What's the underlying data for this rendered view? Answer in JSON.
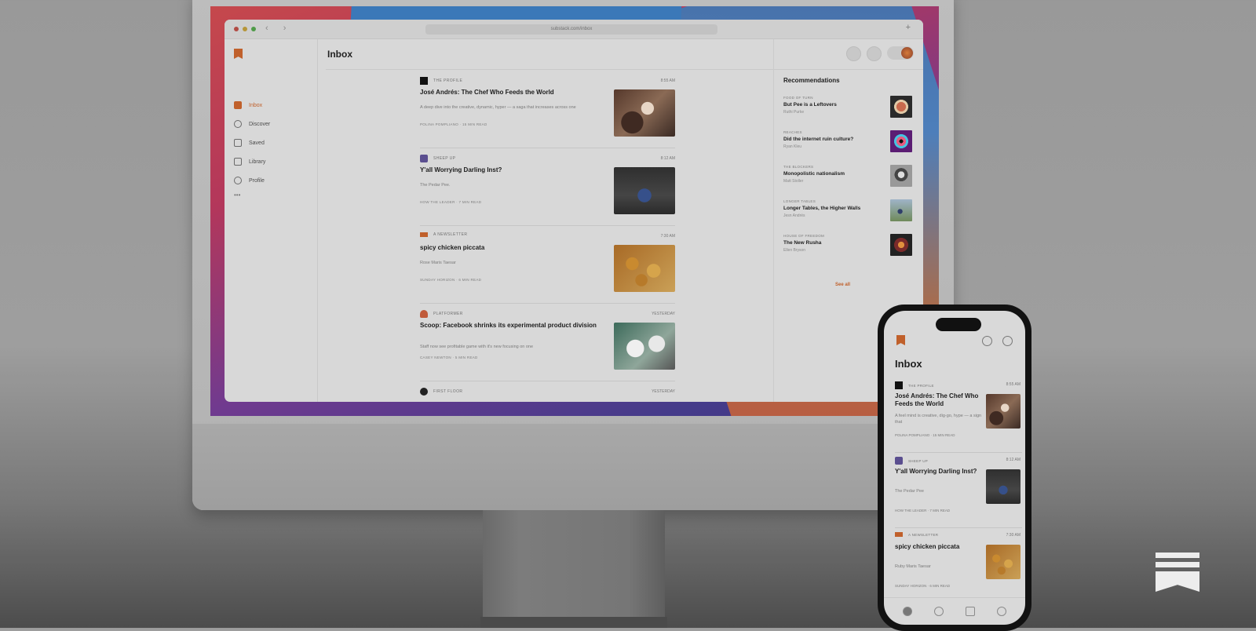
{
  "desktop": {
    "url": "substack.com/inbox",
    "nav": [
      {
        "label": "Inbox"
      },
      {
        "label": "Discover"
      },
      {
        "label": "Saved"
      },
      {
        "label": "Library"
      },
      {
        "label": "Profile"
      }
    ],
    "nav_more": "•••",
    "page_title": "Inbox",
    "posts": [
      {
        "publication": "THE PROFILE",
        "time": "8:55 AM",
        "title": "José Andrés: The Chef Who Feeds the World",
        "subtitle": "A deep dive into the creative, dynamic, hyper — a saga that increases across one",
        "meta": "POLINA POMPLIANO  ·  15 MIN READ",
        "thumb": "chef-photo"
      },
      {
        "publication": "SHEEP UP",
        "time": "8:12 AM",
        "title": "Y'all Worrying Darling Inst?",
        "subtitle": "The Pedar Pee.",
        "meta": "HOW THE LEADER  ·  7 MIN READ",
        "thumb": "crowd-photo"
      },
      {
        "publication": "A NEWSLETTER",
        "time": "7:30 AM",
        "title": "spicy chicken piccata",
        "subtitle": "Rose Maris Taesar",
        "meta": "SUNDAY HORIZON  ·  6 MIN READ",
        "thumb": "lemon-photo"
      },
      {
        "publication": "PLATFORMER",
        "time": "YESTERDAY",
        "title": "Scoop: Facebook shrinks its experimental product division",
        "subtitle": "Staff now see profitable game with it's new focusing on one",
        "meta": "CASEY NEWTON  ·  5 MIN READ",
        "thumb": "lab-photo"
      },
      {
        "publication": "FIRST FLOOR",
        "time": "YESTERDAY",
        "title": "",
        "subtitle": "",
        "meta": "",
        "thumb": ""
      }
    ],
    "recommendations_title": "Recommendations",
    "recommendations": [
      {
        "kicker": "FOOD OF TURN",
        "headline": "But Pee is a Leftovers",
        "author": "Ruthi Purke",
        "thumb": "dish"
      },
      {
        "kicker": "REACHES",
        "headline": "Did the internet ruin culture?",
        "author": "Ryan Kleu",
        "thumb": "eye"
      },
      {
        "kicker": "THE BLOCKERS",
        "headline": "Monopolistic nationalism",
        "author": "Matt Stoller",
        "thumb": "mono"
      },
      {
        "kicker": "LONGER TABLES",
        "headline": "Longer Tables, the Higher Walls",
        "author": "Jesn Andrés",
        "thumb": "runner"
      },
      {
        "kicker": "HOUSE OF FREEDOM",
        "headline": "The New Rusha",
        "author": "Ellen Bryson",
        "thumb": "neon"
      }
    ],
    "see_all": "See all"
  },
  "phone": {
    "title": "Inbox",
    "posts": [
      {
        "publication": "THE PROFILE",
        "time": "8:55 AM",
        "title": "José Andrés: The Chef Who Feeds the World",
        "subtitle": "A feel mind is creative, dig-go, hype — a sign that",
        "meta": "POLINA POMPLIANO  ·  15 MIN READ"
      },
      {
        "publication": "SHEEP UP",
        "time": "8:12 AM",
        "title": "Y'all Worrying Darling Inst?",
        "subtitle": "The Pedar Pee",
        "meta": "HOW THE LEADER  ·  7 MIN READ"
      },
      {
        "publication": "A NEWSLETTER",
        "time": "7:30 AM",
        "title": "spicy chicken piccata",
        "subtitle": "Ruby Maris Taesar",
        "meta": "SUNDAY HORIZON  ·  6 MIN READ"
      }
    ]
  },
  "colors": {
    "accent": "#c0602b",
    "brand_mark": "#ededed"
  }
}
